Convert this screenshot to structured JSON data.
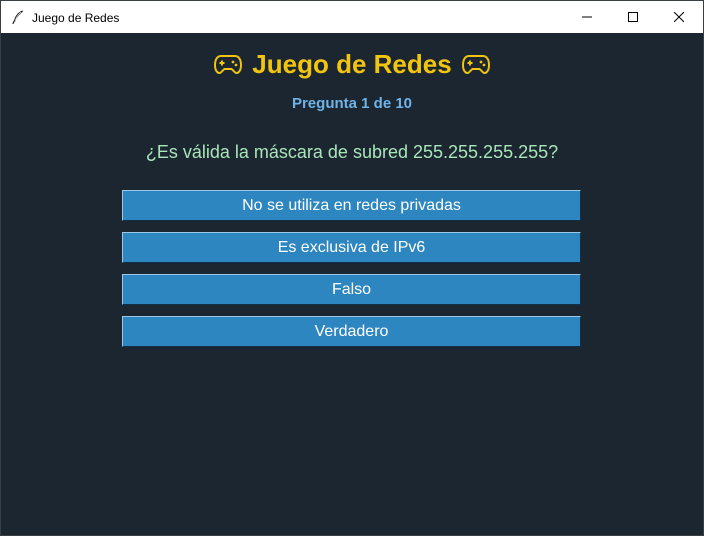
{
  "window": {
    "title": "Juego de Redes",
    "app_icon": "feather-icon",
    "controls": [
      "minimize-icon",
      "maximize-icon",
      "close-icon"
    ]
  },
  "header": {
    "title": "Juego de Redes",
    "icon": "gamepad-icon"
  },
  "progress": {
    "label": "Pregunta 1 de 10",
    "current": 1,
    "total": 10
  },
  "question": {
    "text": "¿Es válida la máscara de subred 255.255.255.255?"
  },
  "answers": [
    {
      "label": "No se utiliza en redes privadas"
    },
    {
      "label": "Es exclusiva de IPv6"
    },
    {
      "label": "Falso"
    },
    {
      "label": "Verdadero"
    }
  ],
  "colors": {
    "background": "#1b2631",
    "title_accent": "#f1c40f",
    "counter": "#6fb3e8",
    "question": "#a8e6b8",
    "button": "#2e86c1",
    "button_text": "#ffffff"
  }
}
